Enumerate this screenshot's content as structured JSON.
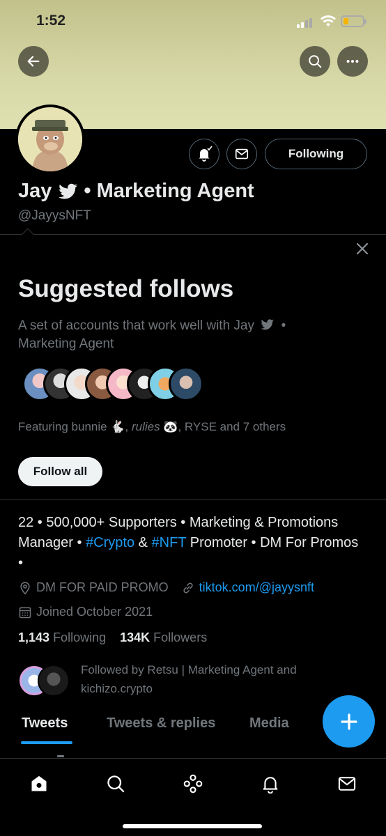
{
  "status": {
    "time": "1:52"
  },
  "profile": {
    "name": "Jay",
    "name_suffix": "• Marketing Agent",
    "handle": "@JayysNFT",
    "following_label": "Following"
  },
  "suggested": {
    "title": "Suggested follows",
    "description_1": "A set of accounts that work well with Jay",
    "description_2": "•",
    "description_3": "Marketing Agent",
    "featuring_prefix": "Featuring bunnie",
    "featuring_rabbit": "🐇",
    "featuring_name2": "rulies",
    "featuring_bear": "🐼",
    "featuring_suffix": ", RYSE and 7 others",
    "follow_all_label": "Follow all"
  },
  "bio": {
    "part1": "22 • 500,000+ Supporters • Marketing & Promotions Manager • ",
    "tag1": "#Crypto",
    "part2": " & ",
    "tag2": "#NFT",
    "part3": " Promoter • DM For Promos •",
    "location": "DM FOR PAID PROMO",
    "website": "tiktok.com/@jayysnft",
    "joined": "Joined October 2021",
    "following_count": "1,143",
    "following_label": "Following",
    "followers_count": "134K",
    "followers_label": "Followers",
    "followed_by": "Followed by Retsu | Marketing Agent and kichizo.crypto"
  },
  "tabs": [
    {
      "label": "Tweets"
    },
    {
      "label": "Tweets & replies"
    },
    {
      "label": "Media"
    }
  ],
  "colors": {
    "accent": "#1d9bf0",
    "muted": "#71767b",
    "text": "#e7e9ea",
    "banner": "#d6d8a7"
  },
  "icons": [
    "back-arrow-icon",
    "search-icon",
    "more-icon",
    "bell-icon",
    "mail-icon",
    "verified-icon",
    "close-icon",
    "location-icon",
    "link-icon",
    "calendar-icon",
    "compose-icon",
    "home-icon",
    "spaces-icon",
    "notifications-icon",
    "messages-icon"
  ]
}
